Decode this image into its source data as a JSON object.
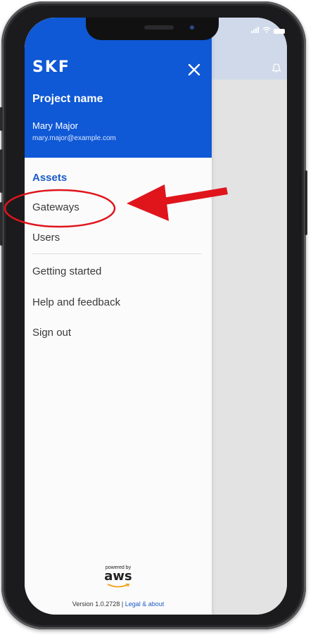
{
  "brand": {
    "logo": "SKF"
  },
  "drawer": {
    "project_name": "Project name",
    "user_name": "Mary Major",
    "user_email": "mary.major@example.com"
  },
  "nav": {
    "section_label": "Assets",
    "items": [
      {
        "label": "Gateways"
      },
      {
        "label": "Users"
      }
    ],
    "secondary": [
      {
        "label": "Getting started"
      },
      {
        "label": "Help and feedback"
      },
      {
        "label": "Sign out"
      }
    ]
  },
  "footer": {
    "powered_by": "powered by",
    "aws_wordmark": "aws",
    "version_text": "Version 1.0.2728 |",
    "legal_link": "Legal & about"
  },
  "colors": {
    "header_blue": "#0f58d6",
    "accent_blue": "#1a5bc8",
    "annotation_red": "#e0151c"
  },
  "icons": [
    "close-icon",
    "bell-icon",
    "signal-icon",
    "wifi-icon",
    "battery-icon"
  ]
}
